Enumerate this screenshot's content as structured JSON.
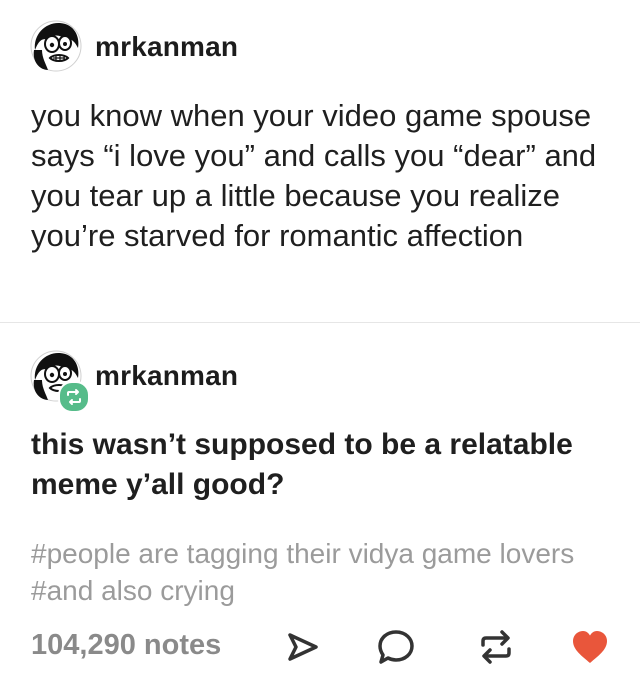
{
  "post_original": {
    "username": "mrkanman",
    "body": "you know when your video game spouse says “i love you” and calls you “dear” and you tear up a little because you realize you’re starved for romantic affection"
  },
  "post_reblog": {
    "username": "mrkanman",
    "body": "this wasn’t supposed to be a relatable meme y’all good?",
    "tags": [
      "#people are tagging their vidya game lovers",
      "#and also crying"
    ],
    "notes": "104,290 notes"
  },
  "icons": {
    "share": "share-arrow-icon",
    "reply": "reply-bubble-icon",
    "reblog": "reblog-icon",
    "like": "heart-icon"
  },
  "colors": {
    "like": "#e9563b",
    "reblog_badge": "#56bc8a",
    "tag_text": "#9b9b9b",
    "notes_text": "#8a8a8a"
  }
}
